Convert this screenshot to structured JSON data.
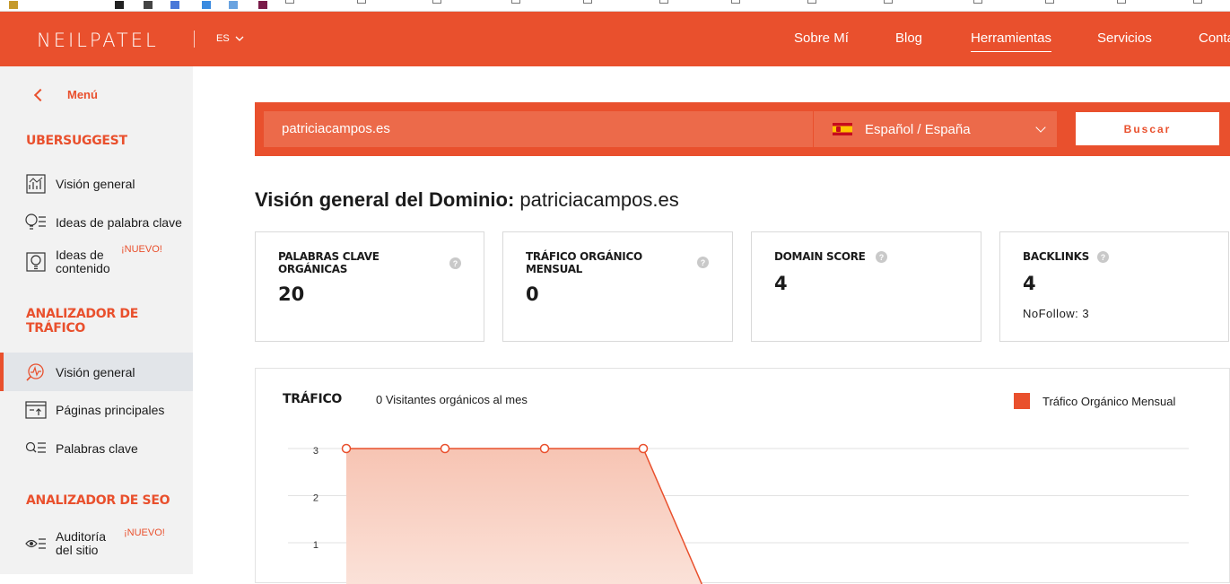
{
  "brand": {
    "logo": "NEILPATEL",
    "lang_code": "ES",
    "accent_color": "#e9502d"
  },
  "nav": {
    "items": [
      {
        "label": "Sobre Mí",
        "active": false
      },
      {
        "label": "Blog",
        "active": false
      },
      {
        "label": "Herramientas",
        "active": true
      },
      {
        "label": "Servicios",
        "active": false
      },
      {
        "label": "Conta",
        "active": false
      }
    ]
  },
  "sidebar": {
    "menu_label": "Menú",
    "sections": [
      {
        "title": "UBERSUGGEST",
        "items": [
          {
            "label": "Visión general",
            "icon": "chart-frame-icon"
          },
          {
            "label": "Ideas de palabra clave",
            "icon": "keyword-bulb-icon"
          },
          {
            "label": "Ideas de contenido",
            "icon": "content-bulb-icon",
            "badge": "¡NUEVO!"
          }
        ]
      },
      {
        "title": "ANALIZADOR DE TRÁFICO",
        "items": [
          {
            "label": "Visión general",
            "icon": "traffic-search-icon",
            "active": true
          },
          {
            "label": "Páginas principales",
            "icon": "top-pages-icon"
          },
          {
            "label": "Palabras clave",
            "icon": "keyword-list-icon"
          }
        ]
      },
      {
        "title": "ANALIZADOR DE SEO",
        "items": [
          {
            "label": "Auditoría del sitio",
            "icon": "eye-list-icon",
            "badge": "¡NUEVO!"
          }
        ]
      }
    ]
  },
  "search": {
    "value": "patriciacampos.es",
    "language": "Español / España",
    "button": "Buscar"
  },
  "page": {
    "title_bold": "Visión general del Dominio:",
    "title_domain": " patriciacampos.es"
  },
  "cards": [
    {
      "label": "PALABRAS CLAVE ORGÁNICAS",
      "value": "20"
    },
    {
      "label": "TRÁFICO ORGÁNICO MENSUAL",
      "value": "0"
    },
    {
      "label": "DOMAIN SCORE",
      "value": "4"
    },
    {
      "label": "BACKLINKS",
      "value": "4",
      "sub": "NoFollow: 3"
    }
  ],
  "traffic": {
    "label": "TRÁFICO",
    "subtitle": "0 Visitantes orgánicos al mes",
    "legend": "Tráfico Orgánico Mensual"
  },
  "chart_data": {
    "type": "area",
    "title": "",
    "series": [
      {
        "name": "Tráfico Orgánico Mensual",
        "values": [
          3,
          3,
          3,
          3,
          0
        ],
        "color": "#e9502d"
      }
    ],
    "x_index": [
      0,
      1,
      2,
      3,
      4
    ],
    "y_ticks": [
      "3",
      "2",
      "1"
    ],
    "ylim": [
      0,
      3
    ],
    "grid": true
  }
}
